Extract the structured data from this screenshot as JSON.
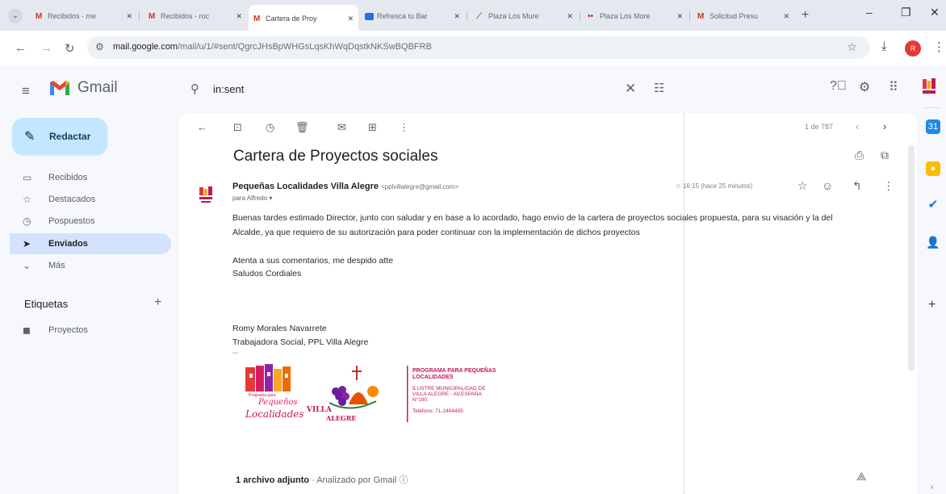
{
  "browser": {
    "tabs": [
      {
        "title": "Recibidos - me",
        "favicon": "gmail-icon"
      },
      {
        "title": "Recibidos - roc",
        "favicon": "gmail-icon"
      },
      {
        "title": "Cartera de Proy",
        "favicon": "gmail-icon",
        "active": true
      },
      {
        "title": "Refresca tu Bar",
        "favicon": "blue-square-icon"
      },
      {
        "title": "Plaza Los Mure",
        "favicon": "green-leaf-icon"
      },
      {
        "title": "Plaza Los More",
        "favicon": "dots-icon"
      },
      {
        "title": "Solicitud Presu",
        "favicon": "gmail-icon"
      }
    ],
    "url_host": "mail.google.com",
    "url_rest": "/mail/u/1/#sent/QgrcJHsBpWHGsLqsKhWqDqstkNKSwBQBFRB",
    "profile_initial": "R"
  },
  "gmail": {
    "app_name": "Gmail",
    "search_query": "in:sent",
    "compose_label": "Redactar",
    "nav": [
      {
        "label": "Recibidos",
        "icon": "inbox-icon",
        "glyph": "▭"
      },
      {
        "label": "Destacados",
        "icon": "star-icon",
        "glyph": "☆"
      },
      {
        "label": "Pospuestos",
        "icon": "clock-icon",
        "glyph": "◷"
      },
      {
        "label": "Enviados",
        "icon": "send-icon",
        "glyph": "➤",
        "active": true
      },
      {
        "label": "Más",
        "icon": "chevron-down-icon",
        "glyph": "⌄"
      }
    ],
    "labels_header": "Etiquetas",
    "labels": [
      {
        "label": "Proyectos",
        "icon": "label-icon"
      }
    ],
    "pager": "1 de 787"
  },
  "email": {
    "subject": "Cartera de Proyectos sociales",
    "sender_name": "Pequeñas Localidades Villa Alegre",
    "sender_email": "<pplvillalegre@gmail.com>",
    "to": "para Alfredo ▾",
    "time": "16:15 (hace 25 minutos)",
    "body": [
      "Buenas tardes estimado Director, junto con saludar y en base a lo acordado, hago envío de la cartera de proyectos sociales propuesta, para su visación y la del",
      "Alcalde, ya que requiero de su autorización para poder continuar con la implementación de dichos proyectos",
      "Atenta a sus comentarios, me despido atte",
      "Saludos Cordiales",
      "Romy Morales Navarrete",
      "Trabajadora Social, PPL Villa Alegre",
      "--"
    ],
    "signature": {
      "logo_text_top": "Programa para",
      "logo_text_mid": "Pequeños",
      "logo_text_bottom": "Localidades",
      "villa_word": "VILLA",
      "alegre_word": "ALEGRE",
      "program_title_1": "PROGRAMA PARA PEQUEÑAS",
      "program_title_2": "LOCALIDADES",
      "muni_1": "ILUSTRE MUNICIPALIDAD DE",
      "muni_2": "VILLA ALEGRE - AV.ESPAÑA",
      "muni_3": "N°190.",
      "phone": "Teléfono: 71-2404455"
    },
    "attachment_count": "1 archivo adjunto",
    "scanned_by": "· Analizado por Gmail ⓘ"
  },
  "colors": {
    "compose_bg": "#c2e7ff",
    "active_nav_bg": "#d3e3fd",
    "gmail_red": "#ea4335",
    "magenta": "#c2185b"
  }
}
